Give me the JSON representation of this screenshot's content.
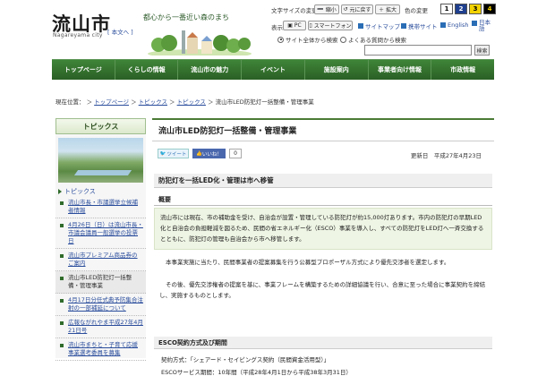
{
  "header": {
    "logo": "流山市",
    "logo_sub": "Nagareyama city",
    "honbun": "[ 本文へ ]",
    "slogan": "都心から一番近い森のまち",
    "fontsize_label": "文字サイズの変更",
    "shrink": "縮小",
    "reset": "元に戻す",
    "enlarge": "拡大",
    "color_label": "色の変更",
    "colors": [
      "1",
      "2",
      "3",
      "4"
    ],
    "display_label": "表示",
    "pc": "PC",
    "smartphone": "スマートフォン",
    "sitemap": "サイトマップ",
    "mobile": "携帯サイト",
    "english": "English",
    "japanese": "日本語",
    "radio_all": "サイト全体から検索",
    "radio_faq": "よくある質問から検索",
    "search_button": "検索"
  },
  "nav": [
    "トップページ",
    "くらしの情報",
    "流山市の魅力",
    "イベント",
    "施設案内",
    "事業者向け情報",
    "市政情報"
  ],
  "breadcrumb": {
    "current_label": "現在位置：",
    "items": [
      "トップページ",
      "トピックス",
      "トピックス"
    ],
    "sep": " ＞ ",
    "current": "流山市LED防犯灯一括整備・管理事業"
  },
  "sidebar": {
    "title": "トピックス",
    "category": "トピックス",
    "items": [
      "流山市長・市議選挙立候補者情報",
      "4月26日（日）は流山市長・市議会議員一般選挙の投票日",
      "流山市プレミアム商品券のご案内",
      "流山市LED防犯灯一括整備・管理事業",
      "4月17日分任式典予防集合注射の一部補延について",
      "広報ながれやま平成27年4月21日号",
      "流山市まちと・子育て応援事業選考委員を募集"
    ]
  },
  "main": {
    "title": "流山市LED防犯灯一括整備・管理事業",
    "tweet": "ツイート",
    "like": "いいね！",
    "like_count": "0",
    "updated": "更新日　平成27年4月23日",
    "h2_1": "防犯灯を一括LED化・管理は市へ移管",
    "h3_1": "概要",
    "summary": "流山市には現在、市の補助金を受け、自治会が設置・管理している防犯灯が約15,000灯あります。市内の防犯灯の早期LED化と自治会の負担軽減を図るため、民間の省エネルギー化（ESCO）事業を導入し、すべての防犯灯をLED灯へ一斉交換するとともに、防犯灯の管理も自治会から市へ移管します。",
    "para1": "本事業実施に当たり、民間事業者の提案募集を行う公募型プロポーザル方式により優先交渉者を選定します。",
    "para2": "その後、優先交渉権者の提案を基に、事業フレームを構築するための詳細協議を行い、合意に至った場合に事業契約を締結し、実施するものとします。",
    "h2_2": "ESCO契約方式及び期間",
    "contract_method": "契約方式：「シェアード・セイビングス契約（民間資金活用型）」",
    "service_period": "ESCOサービス期間：10年間（平成28年4月1日から平成38年3月31日）"
  },
  "colors": {
    "nav": "#2f6b2a",
    "link": "#2a4d9c",
    "summary_bg": "#eef5e4"
  }
}
